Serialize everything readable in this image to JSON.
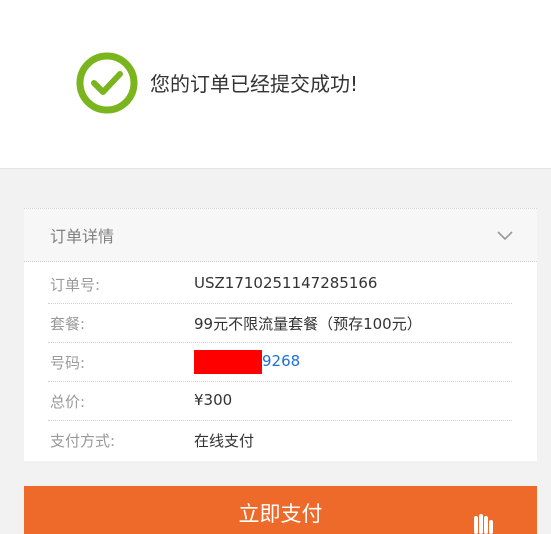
{
  "header": {
    "success_message": "您的订单已经提交成功!"
  },
  "order_details": {
    "title": "订单详情",
    "rows": [
      {
        "label": "订单号:",
        "value": "USZ1710251147285166"
      },
      {
        "label": "套餐:",
        "value": "99元不限流量套餐（预存100元）"
      },
      {
        "label": "号码:",
        "value": "9268"
      },
      {
        "label": "总价:",
        "value": "¥300"
      },
      {
        "label": "支付方式:",
        "value": "在线支付"
      }
    ]
  },
  "actions": {
    "pay_now_label": "立即支付"
  },
  "colors": {
    "success_green": "#7ab51d",
    "primary_orange": "#ee6a2a",
    "link_blue": "#1f6fd6",
    "redaction_red": "#ff0000"
  },
  "icons": {
    "success": "check-circle-icon",
    "expand": "chevron-down-icon",
    "tap": "tap-hand-icon"
  }
}
